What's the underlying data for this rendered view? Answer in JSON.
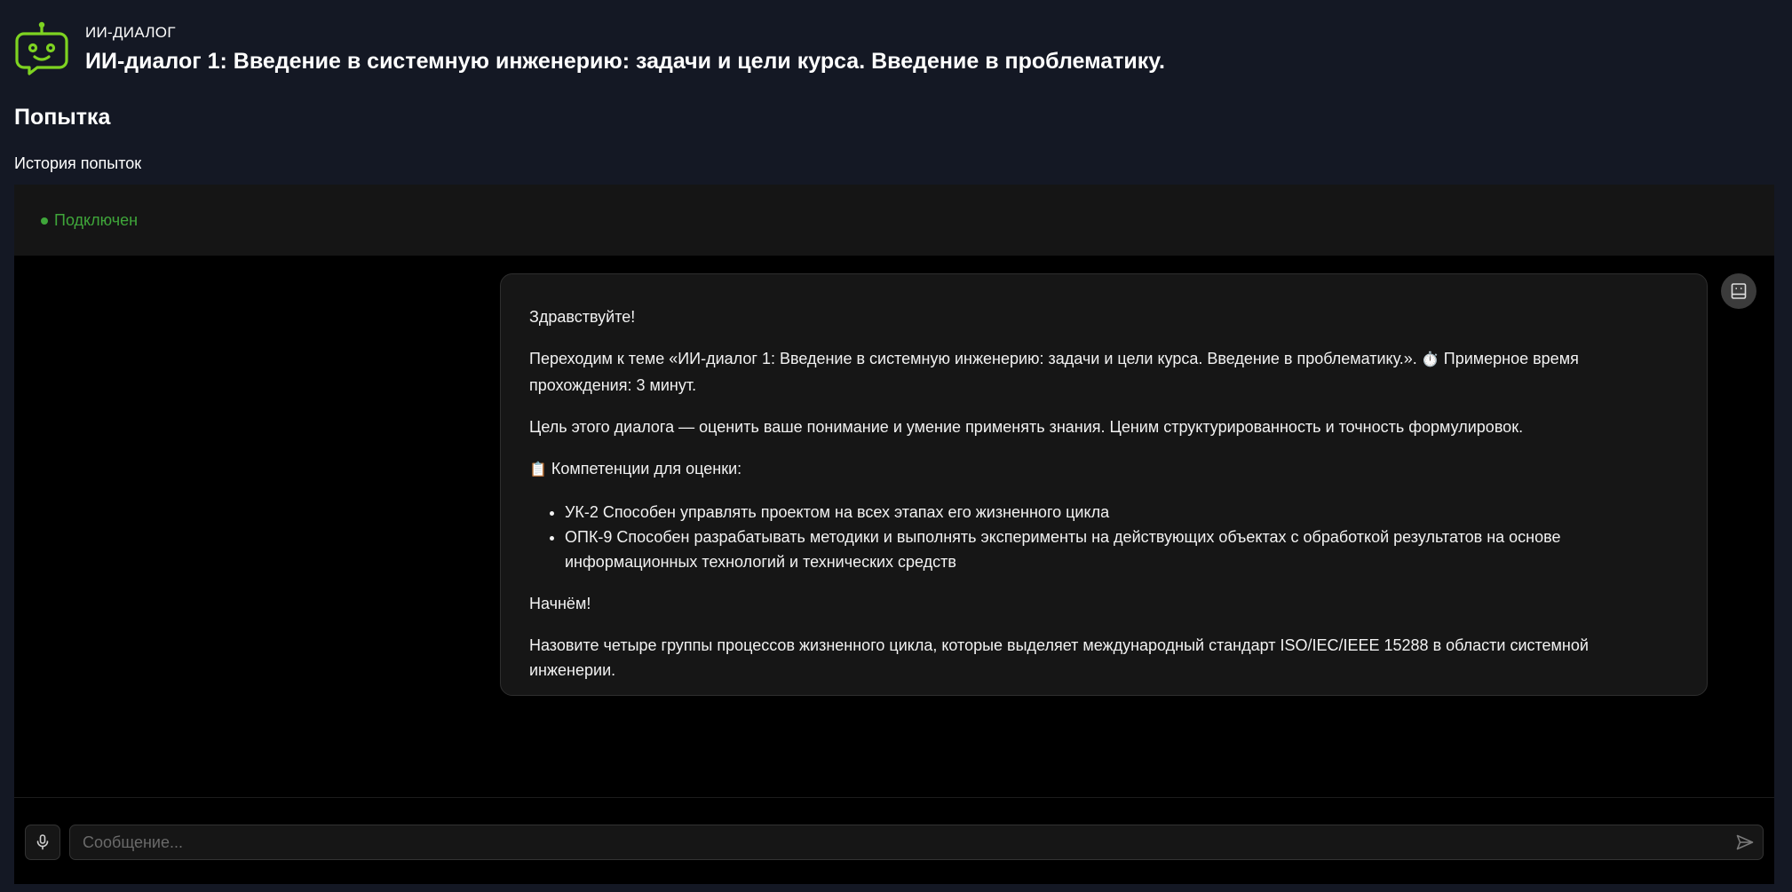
{
  "header": {
    "kicker": "ИИ-ДИАЛОГ",
    "title": "ИИ-диалог 1: Введение в системную инженерию: задачи и цели курса. Введение в проблематику.",
    "logo_icon": "robot-chat-icon",
    "accent_color": "#7ed321"
  },
  "attempt": {
    "heading": "Попытка",
    "history_link": "История попыток"
  },
  "chat": {
    "status": "Подключен",
    "status_color": "#3fa63a",
    "assistant_avatar_icon": "robot-face-icon",
    "message": {
      "greeting": "Здравствуйте!",
      "intro_prefix": "Переходим к теме «ИИ-диалог 1: Введение в системную инженерию: задачи и цели курса. Введение в проблематику.».",
      "timer_emoji": "⏱️",
      "intro_suffix": " Примерное время прохождения: 3 минут.",
      "goal": "Цель этого диалога — оценить ваше понимание и умение применять знания. Ценим структурированность и точность формулировок.",
      "competencies_emoji": "📋",
      "competencies_title": " Компетенции для оценки:",
      "competencies": [
        "УК-2 Способен управлять проектом на всех этапах его жизненного цикла",
        "ОПК-9 Способен разрабатывать методики и выполнять эксперименты на действующих объектах с обработкой результатов на основе информационных технологий и технических средств"
      ],
      "start": "Начнём!",
      "question": "Назовите четыре группы процессов жизненного цикла, которые выделяет международный стандарт ISO/IEC/IEEE 15288 в области системной инженерии."
    }
  },
  "composer": {
    "placeholder": "Сообщение...",
    "value": "",
    "mic_icon": "microphone-icon",
    "send_icon": "send-icon"
  }
}
